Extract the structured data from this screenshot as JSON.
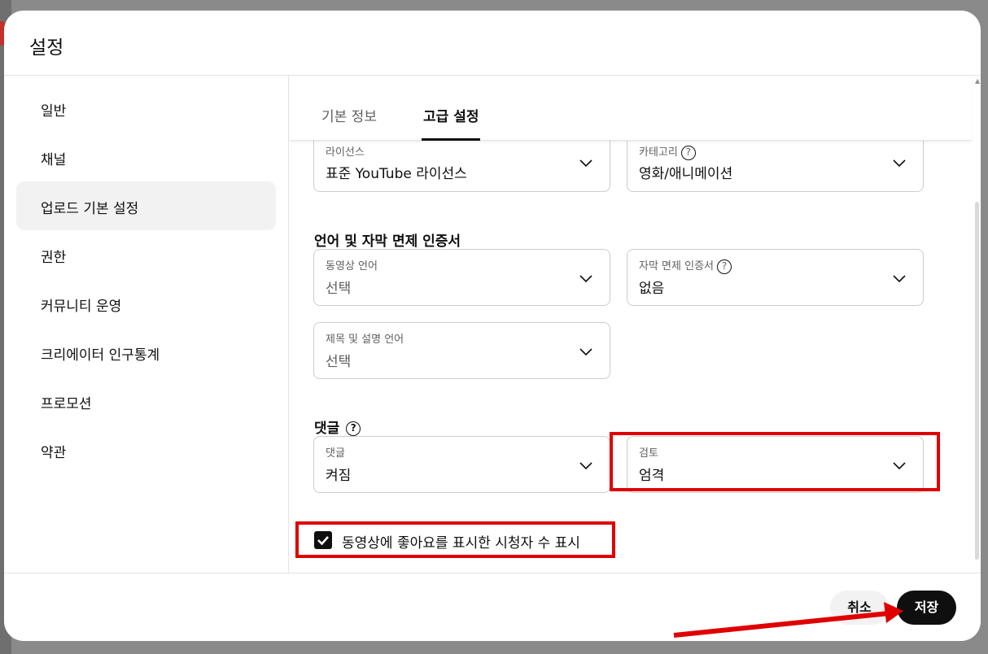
{
  "dialog": {
    "title": "설정"
  },
  "sidebar": {
    "items": [
      {
        "label": "일반"
      },
      {
        "label": "채널"
      },
      {
        "label": "업로드 기본 설정"
      },
      {
        "label": "권한"
      },
      {
        "label": "커뮤니티 운영"
      },
      {
        "label": "크리에이터 인구통계"
      },
      {
        "label": "프로모션"
      },
      {
        "label": "약관"
      }
    ],
    "active": "업로드 기본 설정"
  },
  "tabs": [
    {
      "label": "기본 정보"
    },
    {
      "label": "고급 설정"
    }
  ],
  "active_tab": "고급 설정",
  "fields": {
    "license": {
      "label": "라이선스",
      "value": "표준 YouTube 라이선스"
    },
    "category": {
      "label": "카테고리",
      "value": "영화/애니메이션"
    },
    "video_language": {
      "label": "동영상 언어",
      "value": "선택"
    },
    "caption_cert": {
      "label": "자막 면제 인증서",
      "value": "없음"
    },
    "title_desc_language": {
      "label": "제목 및 설명 언어",
      "value": "선택"
    },
    "comments": {
      "label": "댓글",
      "value": "켜짐"
    },
    "review": {
      "label": "검토",
      "value": "엄격"
    }
  },
  "sections": {
    "language_title": "언어 및 자막 면제 인증서",
    "comments_title": "댓글"
  },
  "checkbox": {
    "label": "동영상에 좋아요를 표시한 시청자 수 표시",
    "checked": true
  },
  "footer": {
    "cancel": "취소",
    "save": "저장"
  },
  "colors": {
    "highlight": "#e00000",
    "primary_button": "#0f0f0f"
  }
}
